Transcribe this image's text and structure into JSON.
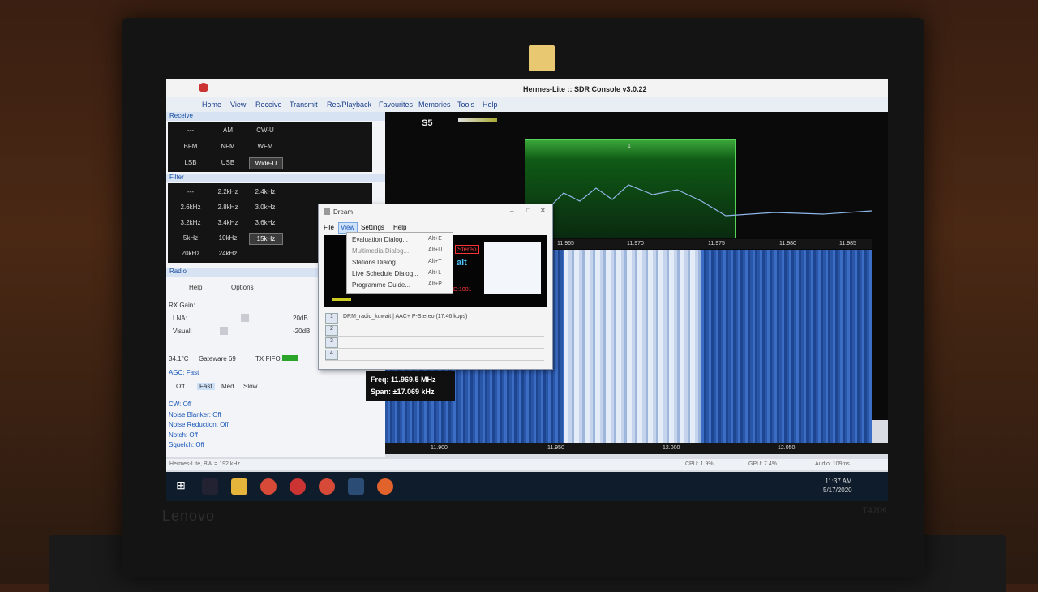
{
  "app": {
    "title": "Hermes-Lite :: SDR Console v3.0.22"
  },
  "ribbon": [
    "Home",
    "View",
    "Receive",
    "Transmit",
    "Rec/Playback",
    "Favourites",
    "Memories",
    "Tools",
    "Help"
  ],
  "left": {
    "receive_label": "Receive",
    "modes": [
      [
        "---",
        "AM",
        "CW-U"
      ],
      [
        "BFM",
        "NFM",
        "WFM"
      ],
      [
        "LSB",
        "USB",
        "Wide-U"
      ]
    ],
    "selected_mode": "Wide-U",
    "filter_label": "Filter",
    "filters": [
      [
        "---",
        "2.2kHz",
        "2.4kHz"
      ],
      [
        "2.6kHz",
        "2.8kHz",
        "3.0kHz"
      ],
      [
        "3.2kHz",
        "3.4kHz",
        "3.6kHz"
      ],
      [
        "5kHz",
        "10kHz",
        "15kHz"
      ],
      [
        "20kHz",
        "24kHz",
        ""
      ]
    ],
    "selected_filter": "15kHz",
    "radio_label": "Radio",
    "help": "Help",
    "options": "Options",
    "rx_gain": "RX Gain:",
    "lna": "LNA:",
    "lna_val": "20dB",
    "visual": "Visual:",
    "visual_val": "-20dB",
    "temp": "34.1°C",
    "gateware": "Gateware 69",
    "txfifo": "TX FIFO:",
    "agc": "AGC: Fast",
    "agc_btns": [
      "Off",
      "Fast",
      "Med",
      "Slow"
    ],
    "cw": "CW: Off",
    "nb": "Noise Blanker: Off",
    "nr": "Noise Reduction: Off",
    "notch": "Notch: Off",
    "squelch": "Squelch: Off"
  },
  "spectrum": {
    "smeter": "S5",
    "marker": "1",
    "top_freqs": [
      "11.965",
      "11.970",
      "11.975",
      "11.980",
      "11.985"
    ],
    "bottom_freqs": [
      "11.900",
      "11.950",
      "12.000",
      "12.050"
    ],
    "freq_line": "Freq: 11.969.5 MHz",
    "span_line": "Span: ±17.069 kHz"
  },
  "dream": {
    "title": "Dream",
    "menu": [
      "File",
      "View",
      "Settings",
      "Help"
    ],
    "dropdown": [
      [
        "Evaluation Dialog...",
        "Alt+E"
      ],
      [
        "Multimedia Dialog...",
        "Alt+U"
      ],
      [
        "Stations Dialog...",
        "Alt+T"
      ],
      [
        "Live Schedule Dialog...",
        "Alt+L"
      ],
      [
        "Programme Guide...",
        "Alt+P"
      ]
    ],
    "display_stereo": "Stereo",
    "display_ait": "ait",
    "display_id": "D:1001",
    "services": [
      [
        "1",
        "DRM_radio_kuwait  |  AAC+ P-Stereo (17.46 kbps)"
      ],
      [
        "2",
        ""
      ],
      [
        "3",
        ""
      ],
      [
        "4",
        ""
      ]
    ]
  },
  "status": {
    "left": "Hermes-Lite, BW = 192 kHz",
    "cpu": "CPU: 1.9%",
    "gpu": "GPU: 7.4%",
    "audio": "Audio: 109ms"
  },
  "clock": {
    "time": "11:37 AM",
    "date": "5/17/2020"
  },
  "bezel": {
    "brand": "Lenovo",
    "model": "T470s"
  }
}
